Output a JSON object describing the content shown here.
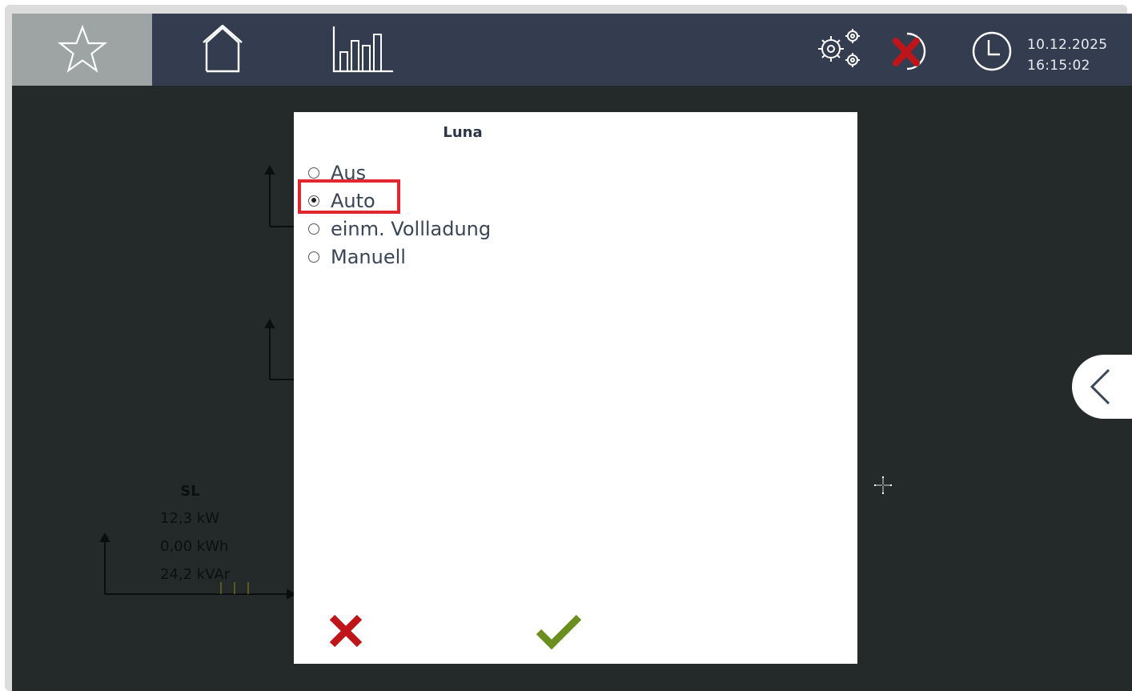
{
  "header": {
    "nav": [
      {
        "name": "favorites",
        "icon": "star-icon"
      },
      {
        "name": "home",
        "icon": "house-icon"
      },
      {
        "name": "statistics",
        "icon": "bar-chart-icon"
      }
    ],
    "settings_icon": "gears-icon",
    "disconnected_icon": "connection-error-icon",
    "clock_icon": "clock-icon",
    "date": "10.12.2025",
    "time": "16:15:02"
  },
  "background": {
    "sl_title": "SL",
    "sl_power": "12,3 kW",
    "sl_energy": "0,00 kWh",
    "sl_reactive": "24,2 kVAr"
  },
  "dialog": {
    "title": "Luna",
    "options": [
      "Aus",
      "Auto",
      "einm. Vollladung",
      "Manuell"
    ],
    "selected": "Auto",
    "cancel_icon": "cancel-x-icon",
    "confirm_icon": "checkmark-icon"
  },
  "side_panel_toggle_icon": "chevron-left-icon",
  "colors": {
    "topbar": "#343d4f",
    "active_nav": "#9ea4a4",
    "screen_bg": "#232a29",
    "highlight": "#e0262f",
    "cancel": "#c0141b",
    "confirm": "#6a8f1f"
  }
}
